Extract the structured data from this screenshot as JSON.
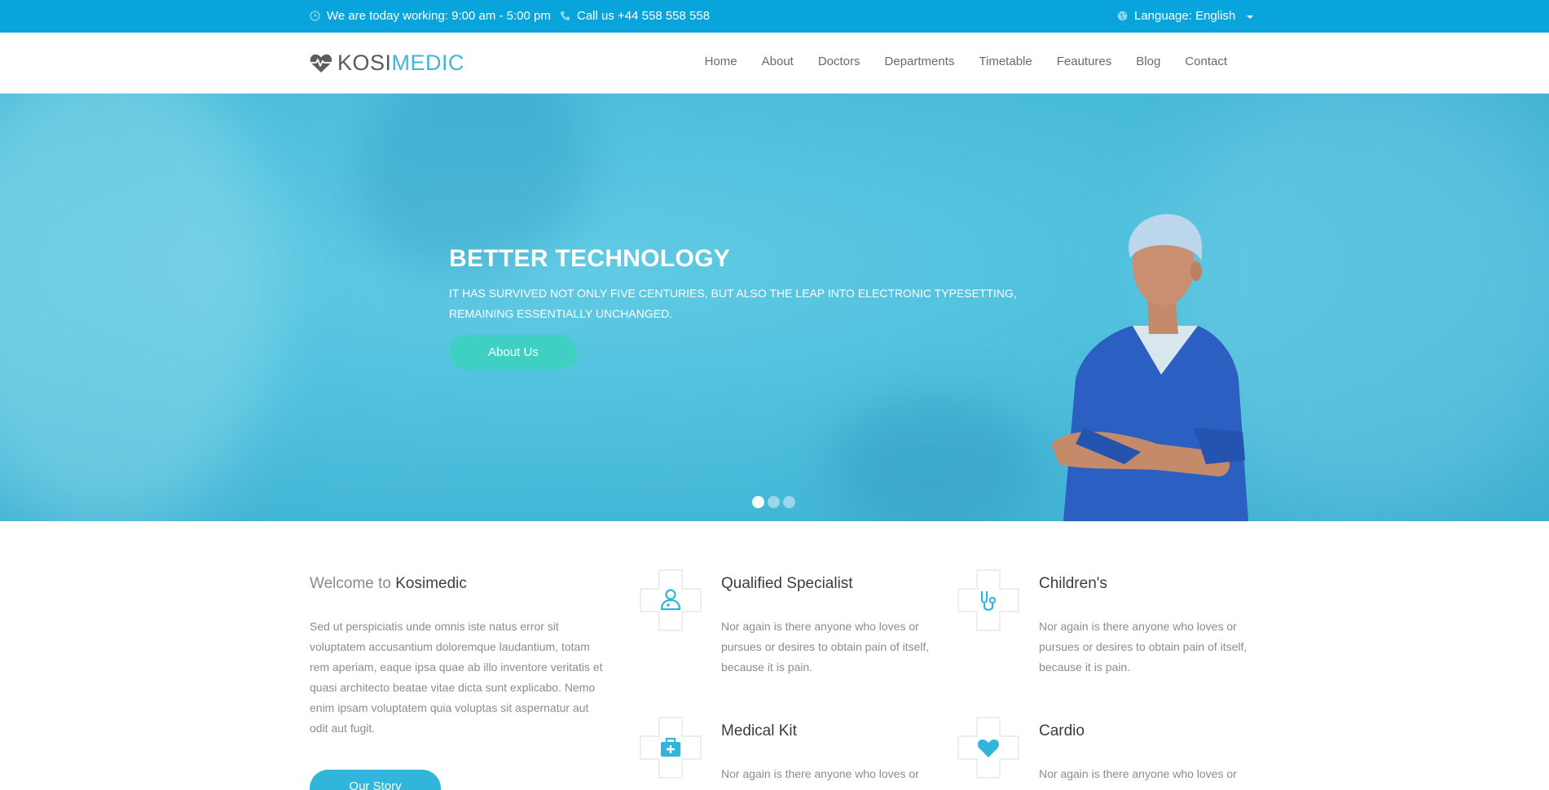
{
  "topbar": {
    "hours": "We are today working: 9:00 am - 5:00 pm",
    "phone": "Call us +44 558 558 558",
    "language": "Language: English"
  },
  "header": {
    "logo_part1": "KOSI",
    "logo_part2": "MEDIC",
    "nav": [
      "Home",
      "About",
      "Doctors",
      "Departments",
      "Timetable",
      "Feautures",
      "Blog",
      "Contact"
    ]
  },
  "hero": {
    "title": "BETTER TECHNOLOGY",
    "subtitle": "IT HAS SURVIVED NOT ONLY FIVE CENTURIES, BUT ALSO THE LEAP INTO ELECTRONIC TYPESETTING, REMAINING ESSENTIALLY UNCHANGED.",
    "button": "About Us",
    "slides_total": 3,
    "slide_active": 1
  },
  "welcome": {
    "title_prefix": "Welcome to",
    "title_name": "Kosimedic",
    "text": "Sed ut perspiciatis unde omnis iste natus error sit voluptatem accusantium doloremque laudantium, totam rem aperiam, eaque ipsa quae ab illo inventore veritatis et quasi architecto beatae vitae dicta sunt explicabo. Nemo enim ipsam voluptatem quia voluptas sit aspernatur aut odit aut fugit.",
    "button": "Our Story"
  },
  "features": [
    {
      "title": "Qualified Specialist",
      "text": "Nor again is there anyone who loves or pursues or desires to obtain pain of itself, because it is pain.",
      "icon": "doctor-icon"
    },
    {
      "title": "Children's",
      "text": "Nor again is there anyone who loves or pursues or desires to obtain pain of itself, because it is pain.",
      "icon": "stethoscope-icon"
    },
    {
      "title": "Medical Kit",
      "text": "Nor again is there anyone who loves or pursues or desires to obtain pain of itself, because it is pain.",
      "icon": "medical-kit-icon"
    },
    {
      "title": "Cardio",
      "text": "Nor again is there anyone who loves or pursues or desires to obtain pain of itself, because it is pain.",
      "icon": "heart-icon"
    }
  ],
  "colors": {
    "topbar": "#0aa4dc",
    "accent": "#31b5db",
    "hero_button": "#3fd0c3"
  }
}
